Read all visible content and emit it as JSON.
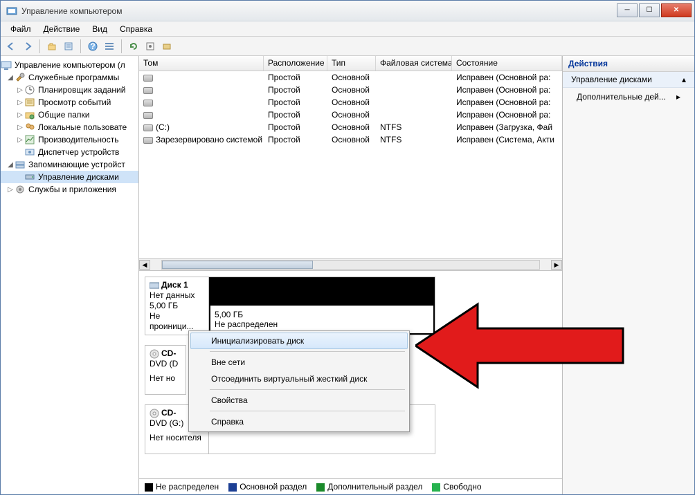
{
  "window": {
    "title": "Управление компьютером"
  },
  "menubar": [
    "Файл",
    "Действие",
    "Вид",
    "Справка"
  ],
  "tree": {
    "root": "Управление компьютером (л",
    "n1": "Служебные программы",
    "n1_1": "Планировщик заданий",
    "n1_2": "Просмотр событий",
    "n1_3": "Общие папки",
    "n1_4": "Локальные пользовате",
    "n1_5": "Производительность",
    "n1_6": "Диспетчер устройств",
    "n2": "Запоминающие устройст",
    "n2_1": "Управление дисками",
    "n3": "Службы и приложения"
  },
  "columns": {
    "volume": "Том",
    "layout": "Расположение",
    "type": "Тип",
    "fs": "Файловая система",
    "status": "Состояние"
  },
  "volumes": [
    {
      "name": "",
      "layout": "Простой",
      "type": "Основной",
      "fs": "",
      "status": "Исправен (Основной ра:"
    },
    {
      "name": "",
      "layout": "Простой",
      "type": "Основной",
      "fs": "",
      "status": "Исправен (Основной ра:"
    },
    {
      "name": "",
      "layout": "Простой",
      "type": "Основной",
      "fs": "",
      "status": "Исправен (Основной ра:"
    },
    {
      "name": "",
      "layout": "Простой",
      "type": "Основной",
      "fs": "",
      "status": "Исправен (Основной ра:"
    },
    {
      "name": "(C:)",
      "layout": "Простой",
      "type": "Основной",
      "fs": "NTFS",
      "status": "Исправен (Загрузка, Фай"
    },
    {
      "name": "Зарезервировано системой",
      "layout": "Простой",
      "type": "Основной",
      "fs": "NTFS",
      "status": "Исправен (Система, Акти"
    }
  ],
  "disk1": {
    "name": "Диск 1",
    "line1": "Нет данных",
    "line2": "5,00 ГБ",
    "line3": "Не проиници...",
    "part_size": "5,00 ГБ",
    "part_state": "Не распределен"
  },
  "cd1": {
    "name": "CD-",
    "line1": "DVD (D",
    "line2": "Нет но"
  },
  "cd2": {
    "name": "CD-",
    "line1": "DVD (G:)",
    "line2": "Нет носителя"
  },
  "legend": {
    "unalloc": "Не распределен",
    "primary": "Основной раздел",
    "extended": "Дополнительный раздел",
    "free": "Свободно"
  },
  "actions": {
    "header": "Действия",
    "section": "Управление дисками",
    "more": "Дополнительные дей..."
  },
  "context_menu": {
    "init": "Инициализировать диск",
    "offline": "Вне сети",
    "detach": "Отсоединить виртуальный жесткий диск",
    "props": "Свойства",
    "help": "Справка"
  },
  "colors": {
    "unalloc": "#000000",
    "primary": "#1c3f94",
    "extended": "#1a8a2a",
    "free": "#27b34f"
  }
}
